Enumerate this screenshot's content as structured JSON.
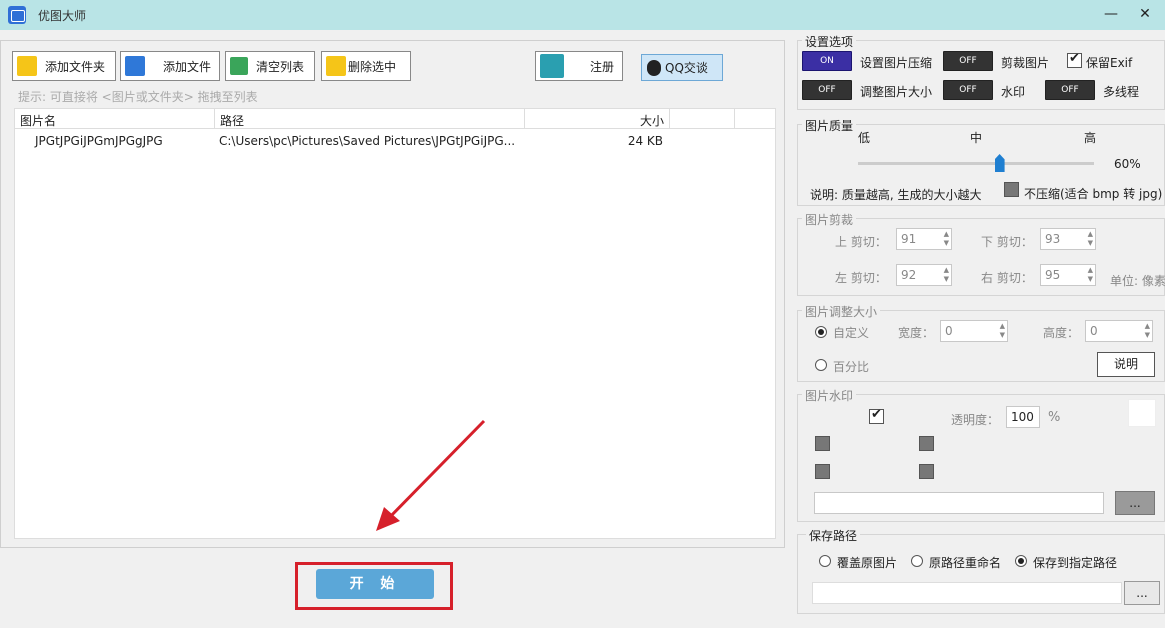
{
  "window": {
    "title": "优图大师",
    "minimize": "—",
    "close": "✕"
  },
  "toolbar": {
    "add_folder": "添加文件夹",
    "add_file": "添加文件",
    "clear_list": "清空列表",
    "delete_selected": "删除选中",
    "register": "注册",
    "qq_chat": "QQ交谈"
  },
  "hint": "提示: 可直接将 <图片或文件夹> 拖拽至列表",
  "table": {
    "headers": [
      "图片名",
      "路径",
      "大小"
    ],
    "rows": [
      {
        "name": "JPGtJPGiJPGmJPGgJPG",
        "path": "C:\\Users\\pc\\Pictures\\Saved Pictures\\JPGtJPGiJPG...",
        "size": "24 KB"
      }
    ]
  },
  "start_button": "开 始",
  "settings": {
    "title": "设置选项",
    "compress_label": "设置图片压缩",
    "compress_state": "ON",
    "crop_label": "剪裁图片",
    "crop_state": "OFF",
    "keep_exif_label": "保留Exif",
    "resize_label": "调整图片大小",
    "resize_state": "OFF",
    "watermark_label": "水印",
    "watermark_state": "OFF",
    "multithread_label": "多线程",
    "multithread_state": "OFF"
  },
  "quality": {
    "title": "图片质量",
    "low": "低",
    "mid": "中",
    "high": "高",
    "value": "60%",
    "slider_fraction": 0.6,
    "note": "说明: 质量越高, 生成的大小越大",
    "no_compress": "不压缩(适合 bmp 转 jpg)"
  },
  "crop": {
    "title": "图片剪裁",
    "top_label": "上 剪切：",
    "top_value": "91",
    "bottom_label": "下 剪切：",
    "bottom_value": "93",
    "left_label": "左 剪切：",
    "left_value": "92",
    "right_label": "右 剪切：",
    "right_value": "95",
    "unit": "单位: 像素"
  },
  "resize": {
    "title": "图片调整大小",
    "custom": "自定义",
    "width_label": "宽度：",
    "width_value": "0",
    "height_label": "高度：",
    "height_value": "0",
    "percent": "百分比",
    "explain_button": "说明"
  },
  "watermark": {
    "title": "图片水印",
    "opacity_label": "透明度：",
    "opacity_value": "100",
    "opacity_unit": "%",
    "browse_button": "..."
  },
  "save_path": {
    "title": "保存路径",
    "overwrite": "覆盖原图片",
    "rename": "原路径重命名",
    "save_to": "保存到指定路径",
    "browse_button": "..."
  },
  "colors": {
    "accent_on": "#3b2fa4",
    "start_button": "#5ba7d8",
    "highlight": "#d6202b",
    "titlebar": "#b9e4e6"
  }
}
